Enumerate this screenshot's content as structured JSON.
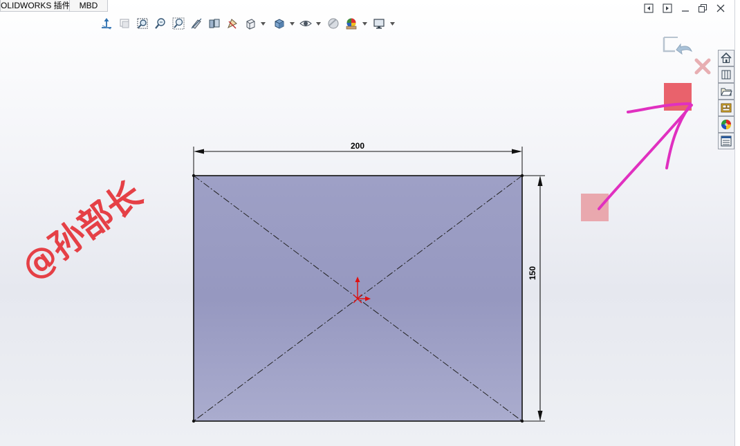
{
  "tabs": [
    {
      "label": "OLIDWORKS 插件"
    },
    {
      "label": "MBD"
    }
  ],
  "toolbar": {
    "buttons": [
      "view-orientation-icon",
      "previous-view-icon",
      "zoom-to-fit-icon",
      "zoom-to-area-icon",
      "zoom-selection-icon",
      "section-view-icon",
      "dynamic-annotation-icon",
      "drawing-annotation-icon",
      "view-orientation-cube-icon",
      "display-style-icon",
      "hide-show-items-icon",
      "edit-appearance-icon",
      "apply-scene-icon",
      "view-settings-icon"
    ]
  },
  "task_pane": {
    "items": [
      "solidworks-resources-home-icon",
      "design-library-icon",
      "file-explorer-icon",
      "view-palette-icon",
      "appearances-scenes-icon",
      "custom-properties-icon"
    ]
  },
  "sketch": {
    "shape": "rectangle",
    "width_dimension": "200",
    "height_dimension": "150",
    "construction_lines": "diagonals",
    "fill_color": "#9c9ec4"
  },
  "watermark": {
    "text": "@孙部长",
    "color": "#e53238"
  },
  "annotation": {
    "arrow_color": "#e030c0",
    "source_box_color": "#e8a0a6",
    "target_box_color": "#e85a64"
  }
}
